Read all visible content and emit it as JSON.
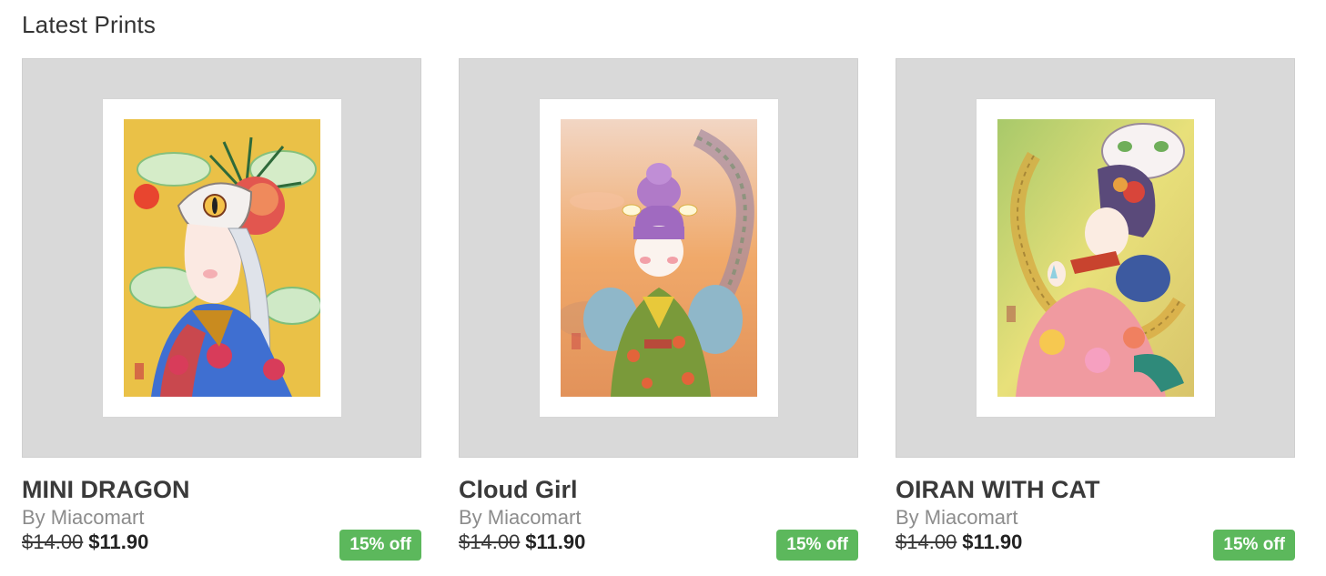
{
  "section": {
    "title": "Latest Prints"
  },
  "products": [
    {
      "title": "MINI DRAGON",
      "artist": "By Miacomart",
      "old_price": "$14.00",
      "new_price": "$11.90",
      "discount": "15% off",
      "art_icon": "dragon-girl-print"
    },
    {
      "title": "Cloud Girl",
      "artist": "By Miacomart",
      "old_price": "$14.00",
      "new_price": "$11.90",
      "discount": "15% off",
      "art_icon": "cloud-girl-print"
    },
    {
      "title": "OIRAN WITH CAT",
      "artist": "By Miacomart",
      "old_price": "$14.00",
      "new_price": "$11.90",
      "discount": "15% off",
      "art_icon": "oiran-cat-print"
    }
  ],
  "colors": {
    "badge_bg": "#5cb85c",
    "thumb_bg": "#d9d9d9",
    "artist_text": "#8c8c8c"
  }
}
